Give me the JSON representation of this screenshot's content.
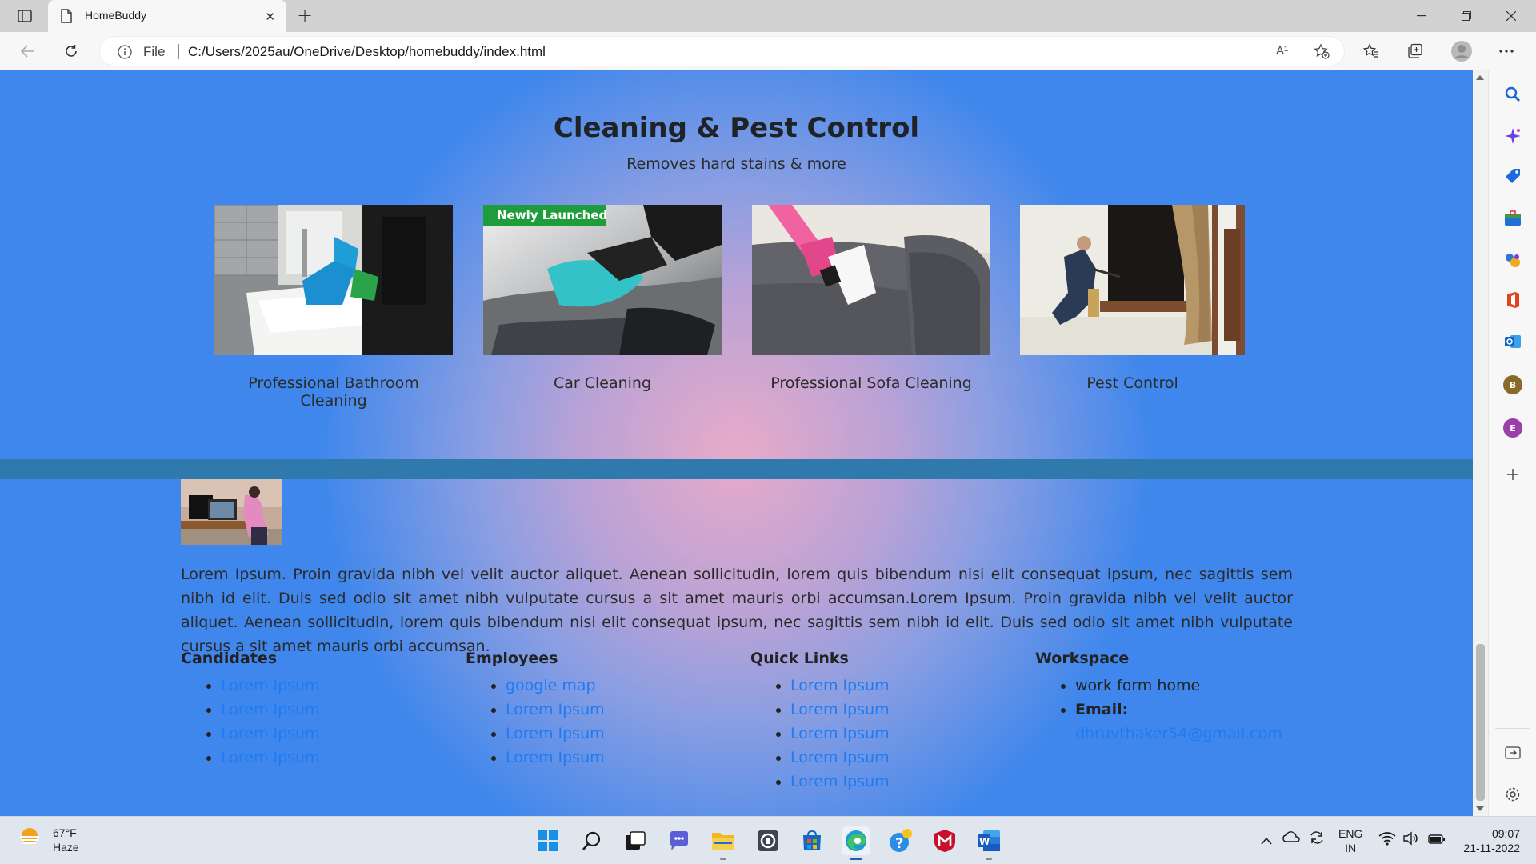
{
  "browser": {
    "tab_title": "HomeBuddy",
    "file_label": "File",
    "url": "C:/Users/2025au/OneDrive/Desktop/homebuddy/index.html",
    "read_aloud": "A¹",
    "new_tab": "+"
  },
  "services": {
    "title": "Cleaning & Pest Control",
    "subtitle": "Removes hard stains & more",
    "cards": [
      {
        "label": "Professional Bathroom Cleaning"
      },
      {
        "label": "Car Cleaning",
        "badge": "Newly Launched"
      },
      {
        "label": "Professional Sofa Cleaning"
      },
      {
        "label": "Pest Control"
      }
    ]
  },
  "about": {
    "text": "Lorem Ipsum. Proin gravida nibh vel velit auctor aliquet. Aenean sollicitudin, lorem quis bibendum nisi elit consequat ipsum, nec sagittis sem nibh id elit. Duis sed odio sit amet nibh vulputate cursus a sit amet mauris orbi accumsan.Lorem Ipsum. Proin gravida nibh vel velit auctor aliquet. Aenean sollicitudin, lorem quis bibendum nisi elit consequat ipsum, nec sagittis sem nibh id elit. Duis sed odio sit amet nibh vulputate cursus a sit amet mauris orbi accumsan."
  },
  "footer": {
    "candidates": {
      "heading": "Candidates",
      "links": [
        "Lorem Ipsum",
        "Lorem Ipsum",
        "Lorem Ipsum",
        "Lorem Ipsum"
      ]
    },
    "employees": {
      "heading": "Employees",
      "links": [
        "google map",
        "Lorem Ipsum",
        "Lorem Ipsum",
        "Lorem Ipsum"
      ]
    },
    "quick_links": {
      "heading": "Quick Links",
      "links": [
        "Lorem Ipsum",
        "Lorem Ipsum",
        "Lorem Ipsum",
        "Lorem Ipsum",
        "Lorem Ipsum"
      ]
    },
    "workspace": {
      "heading": "Workspace",
      "item": "work form home",
      "email_label": "Email:",
      "email": "dhruvthaker54@gmail.com"
    }
  },
  "sidebar": {
    "avatars": [
      {
        "letter": "B",
        "color": "#8a6a2a"
      },
      {
        "letter": "E",
        "color": "#9b3fa8"
      }
    ]
  },
  "taskbar": {
    "weather_temp": "67°F",
    "weather_cond": "Haze",
    "lang_top": "ENG",
    "lang_bottom": "IN",
    "time": "09:07",
    "date": "21-11-2022"
  },
  "colors": {
    "link": "#1e7bf2",
    "divider": "#2f79ad",
    "bg_blue": "#3f87ec",
    "bg_pink": "#e8abc9"
  }
}
